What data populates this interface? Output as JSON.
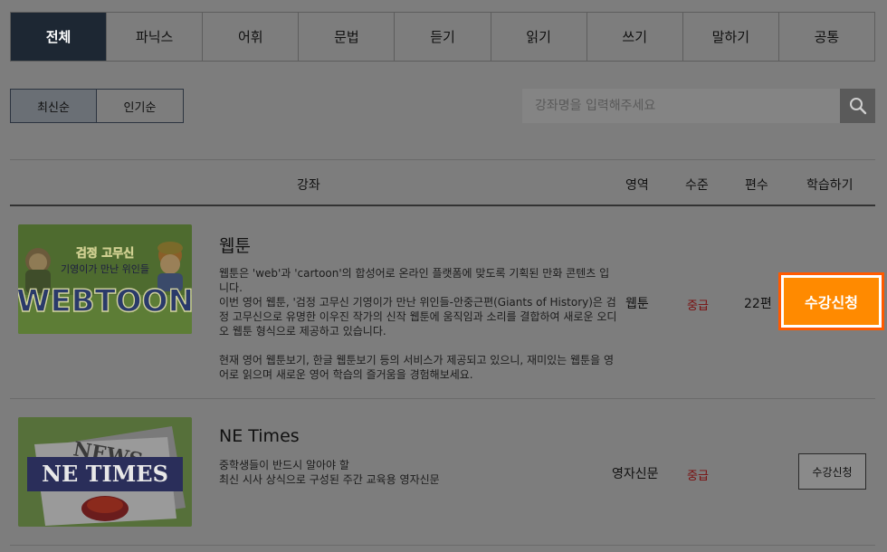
{
  "tabs": [
    {
      "label": "전체",
      "active": true
    },
    {
      "label": "파닉스"
    },
    {
      "label": "어휘"
    },
    {
      "label": "문법"
    },
    {
      "label": "듣기"
    },
    {
      "label": "읽기"
    },
    {
      "label": "쓰기"
    },
    {
      "label": "말하기"
    },
    {
      "label": "공통"
    }
  ],
  "sort": {
    "latest": "최신순",
    "popular": "인기순"
  },
  "search": {
    "placeholder": "강좌명을 입력해주세요",
    "icon": "search-icon"
  },
  "table_header": {
    "course": "강좌",
    "area": "영역",
    "level": "수준",
    "episodes": "편수",
    "action": "학습하기"
  },
  "courses": [
    {
      "title": "웹툰",
      "thumb": {
        "line1": "검정 고무신",
        "line2": "기영이가 만난 위인들",
        "logo": "WEBTOON"
      },
      "desc1": "웹툰은 'web'과 'cartoon'의 합성어로 온라인 플랫폼에 맞도록 기획된 만화 콘텐츠 입니다.",
      "desc2": "이번 영어 웹툰, '검정 고무신 기영이가 만난 위인들-안중근편(Giants of History)은 검정 고무신으로 유명한 이우진 작가의 신작 웹툰에 움직임과 소리를 결합하여 새로운 오디오 웹툰 형식으로 제공하고 있습니다.",
      "desc3": "현재 영어 웹툰보기, 한글 웹툰보기 등의 서비스가 제공되고 있으니, 재미있는 웹툰을 영어로 읽으며 새로운 영어 학습의 즐거움을 경험해보세요.",
      "area": "웹툰",
      "level": "중급",
      "episodes": "22편",
      "button": "수강신청"
    },
    {
      "title": "NE Times",
      "thumb": {
        "news": "NEWS",
        "logo": "NE TIMES"
      },
      "desc1": "중학생들이 반드시 알아야 할",
      "desc2": "최신 시사 상식으로 구성된 주간 교육용 영자신문",
      "area": "영자신문",
      "level": "중급",
      "button": "수강신청"
    }
  ],
  "colors": {
    "active_tab": "#1d2733",
    "accent_button": "#ff8a00",
    "highlight_border": "#ff5a00",
    "level_text": "#7a0e0e"
  }
}
